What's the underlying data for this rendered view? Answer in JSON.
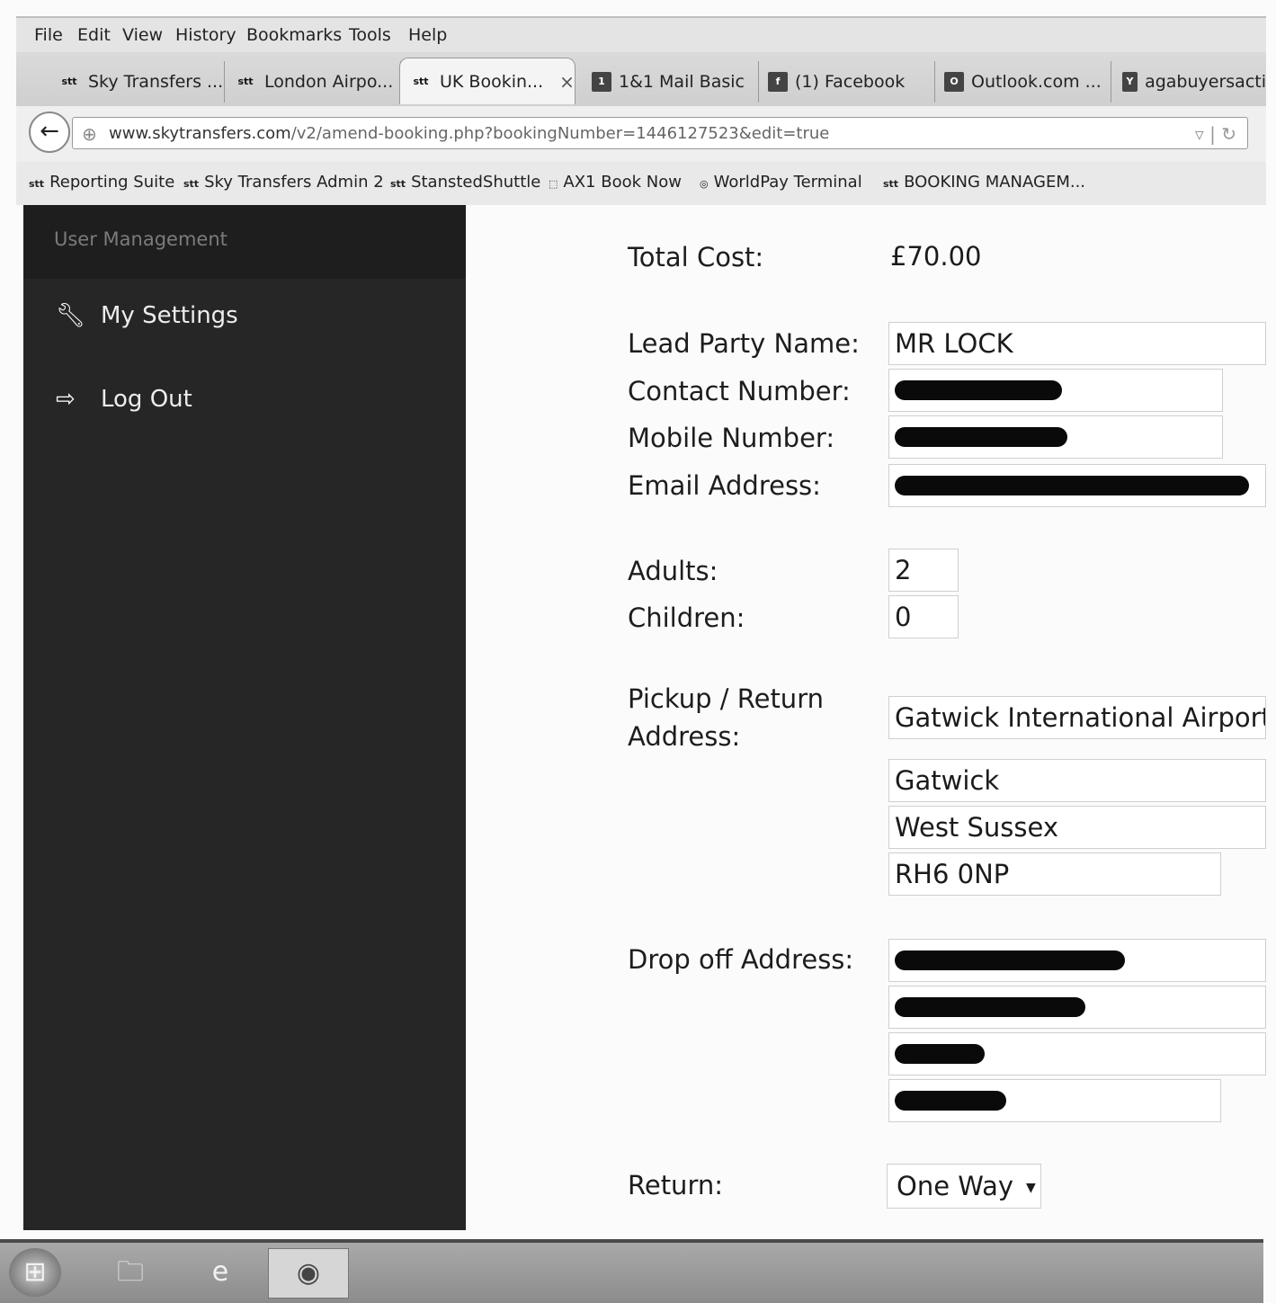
{
  "menubar": [
    "File",
    "Edit",
    "View",
    "History",
    "Bookmarks",
    "Tools",
    "Help"
  ],
  "tabs": [
    {
      "label": "Sky Transfers ...",
      "icon": "skytransfers-icon"
    },
    {
      "label": "London Airpo...",
      "icon": "skytransfers-icon"
    },
    {
      "label": "UK Bookin...",
      "icon": "skytransfers-icon",
      "active": true
    },
    {
      "label": "1&1 Mail Basic",
      "icon": "mail-icon"
    },
    {
      "label": "(1) Facebook",
      "icon": "facebook-icon"
    },
    {
      "label": "Outlook.com ...",
      "icon": "outlook-icon"
    },
    {
      "label": "agabuyersacti",
      "icon": "yahoo-icon"
    }
  ],
  "url": {
    "host": "www.skytransfers.com",
    "path": "/v2/amend-booking.php?bookingNumber=1446127523&edit=true"
  },
  "bookmarks": [
    {
      "label": "Reporting Suite"
    },
    {
      "label": "Sky Transfers Admin 2"
    },
    {
      "label": "StanstedShuttle"
    },
    {
      "label": "AX1 Book Now"
    },
    {
      "label": "WorldPay Terminal"
    },
    {
      "label": "BOOKING MANAGEM..."
    }
  ],
  "sidebar": {
    "title": "User Management",
    "items": [
      {
        "label": "My Settings",
        "icon": "wrench-icon"
      },
      {
        "label": "Log Out",
        "icon": "logout-icon"
      }
    ]
  },
  "form": {
    "total_cost_label": "Total Cost:",
    "total_cost_value": "£70.00",
    "lead_party_label": "Lead Party Name:",
    "lead_party_value": "MR LOCK",
    "contact_label": "Contact Number:",
    "mobile_label": "Mobile Number:",
    "email_label": "Email Address:",
    "adults_label": "Adults:",
    "adults_value": "2",
    "children_label": "Children:",
    "children_value": "0",
    "pickup_label_1": "Pickup / Return",
    "pickup_label_2": "Address:",
    "pickup_line1": "Gatwick International Airport",
    "pickup_line2": "Gatwick",
    "pickup_line3": "West Sussex",
    "pickup_postcode": "RH6 0NP",
    "dropoff_label": "Drop off Address:",
    "return_label": "Return:",
    "return_value": "One Way"
  }
}
